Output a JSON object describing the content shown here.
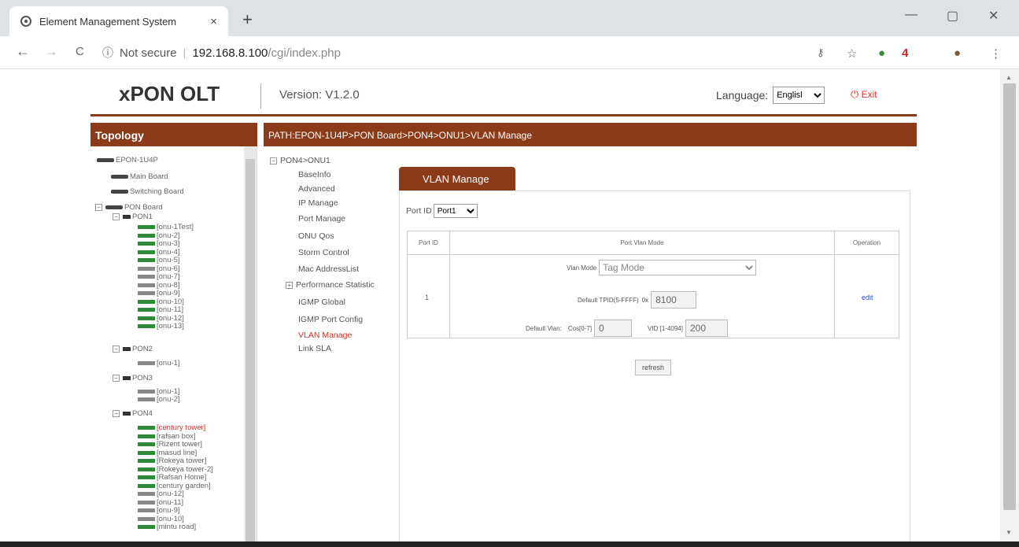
{
  "browser": {
    "tab_title": "Element Management System",
    "tab_close": "×",
    "new_tab": "+",
    "minimize": "—",
    "maximize": "▢",
    "close": "✕",
    "back": "←",
    "forward": "→",
    "reload": "C",
    "security": "Not secure",
    "host": "192.168.8.100",
    "path": "/cgi/index.php",
    "ext_badge": "4"
  },
  "header": {
    "logo": "xPON OLT",
    "version": "Version: V1.2.0",
    "language_label": "Language:",
    "language_value": "Englisl",
    "exit": "Exit"
  },
  "topology": {
    "title": "Topology",
    "root": "EPON-1U4P",
    "main_board": "Main Board",
    "switching_board": "Switching Board",
    "pon_board": "PON Board",
    "pon1": "PON1",
    "pon1_onus": [
      "[onu-1Test]",
      "[onu-2]",
      "[onu-3]",
      "[onu-4]",
      "[onu-5]",
      "[onu-6]",
      "[onu-7]",
      "[onu-8]",
      "[onu-9]",
      "[onu-10]",
      "[onu-11]",
      "[onu-12]",
      "[onu-13]"
    ],
    "pon2": "PON2",
    "pon2_onus": [
      "[onu-1]"
    ],
    "pon3": "PON3",
    "pon3_onus": [
      "[onu-1]",
      "[onu-2]"
    ],
    "pon4": "PON4",
    "pon4_onus": [
      "[century tower]",
      "[rafsan box]",
      "[Rizent tower]",
      "[masud line]",
      "[Rokeya tower]",
      "[Rokeya tower-2]",
      "[Rafsan Home]",
      "[century garden]",
      "[onu-12]",
      "[onu-11]",
      "[onu-9]",
      "[onu-10]",
      "[mintu road]"
    ]
  },
  "path_bar": "PATH:EPON-1U4P>PON Board>PON4>ONU1>VLAN Manage",
  "menu": {
    "root": "PON4>ONU1",
    "items": [
      "BaseInfo",
      "Advanced",
      "IP Manage",
      "Port Manage",
      "ONU Qos",
      "Storm Control",
      "Mac AddressList",
      "Performance Statistic",
      "IGMP Global",
      "IGMP Port Config",
      "VLAN Manage",
      "Link SLA"
    ]
  },
  "panel": {
    "tab": "VLAN Manage",
    "port_id_label": "Port ID",
    "port_id_value": "Port1",
    "col_port": "Port ID",
    "col_mode": "Port Vlan Mode",
    "col_op": "Operation",
    "port_num": "1",
    "vlan_mode_label": "Vlan Mode",
    "vlan_mode_value": "Tag Mode",
    "tpid_label": "Default TPID(5-FFFF)",
    "tpid_prefix": "0x",
    "tpid_value": "8100",
    "default_vlan_label": "Default Vlan:",
    "cos_label": "Cos[0-7]",
    "cos_value": "0",
    "vid_label": "VID [1-4094]",
    "vid_value": "200",
    "edit": "edit",
    "refresh": "refresh"
  }
}
